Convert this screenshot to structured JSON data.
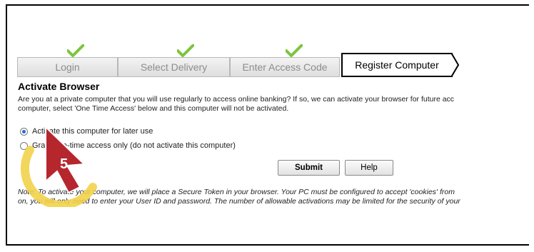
{
  "stepper": {
    "steps": [
      {
        "label": "Login",
        "completed": true
      },
      {
        "label": "Select Delivery",
        "completed": true
      },
      {
        "label": "Enter Access Code",
        "completed": true
      },
      {
        "label": "Register Computer",
        "completed": false,
        "current": true
      }
    ]
  },
  "section": {
    "title": "Activate Browser",
    "description_line1": "Are you at a private computer that you will use regularly to access online banking? If so, we can activate your browser for future acc",
    "description_line2": "computer, select 'One Time Access' below and this computer will not be activated."
  },
  "options": [
    {
      "label": "Activate this computer for later use",
      "selected": true
    },
    {
      "label": "Grant one-time access only (do not activate this computer)",
      "selected": false
    }
  ],
  "buttons": {
    "submit": "Submit",
    "help": "Help"
  },
  "note": {
    "line1": "Note: To activate your computer, we will place a Secure Token in your browser. Your PC must be configured to accept 'cookies' from",
    "line2": "on, you will only need to enter your User ID and password. The number of allowable activations may be limited for the security of your"
  },
  "callout": {
    "number": "5",
    "colors": {
      "ring": "#f2d24a",
      "arrow": "#b5272d"
    }
  },
  "colors": {
    "check": "#7cc53b",
    "radio_selected": "#2a6bd3"
  }
}
